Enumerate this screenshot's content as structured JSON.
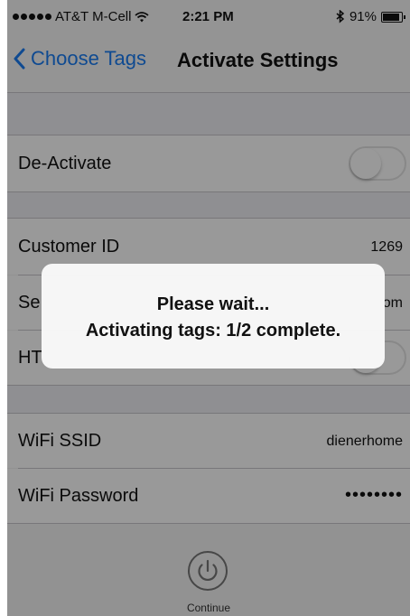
{
  "status_bar": {
    "carrier": "AT&T M-Cell",
    "time": "2:21 PM",
    "battery_percent": "91%",
    "battery_level": 0.91,
    "icons": [
      "signal-dots-icon",
      "wifi-icon",
      "bluetooth-icon",
      "battery-icon"
    ]
  },
  "nav": {
    "back_label": "Choose Tags",
    "title": "Activate Settings",
    "accent_color": "#1a7cf2"
  },
  "settings": {
    "deactivate": {
      "label": "De-Activate",
      "toggle_on": false
    },
    "customer_id": {
      "label": "Customer ID",
      "value": "1269"
    },
    "server": {
      "label": "Se",
      "value": "om"
    },
    "https": {
      "label": "HT",
      "toggle_on": false
    },
    "wifi_ssid": {
      "label": "WiFi SSID",
      "value": "dienerhome"
    },
    "wifi_password": {
      "label": "WiFi Password",
      "value": "••••••••"
    }
  },
  "footer": {
    "continue_label": "Continue",
    "icon": "power-icon"
  },
  "alert": {
    "line1": "Please wait...",
    "line2": "Activating tags: 1/2 complete."
  }
}
